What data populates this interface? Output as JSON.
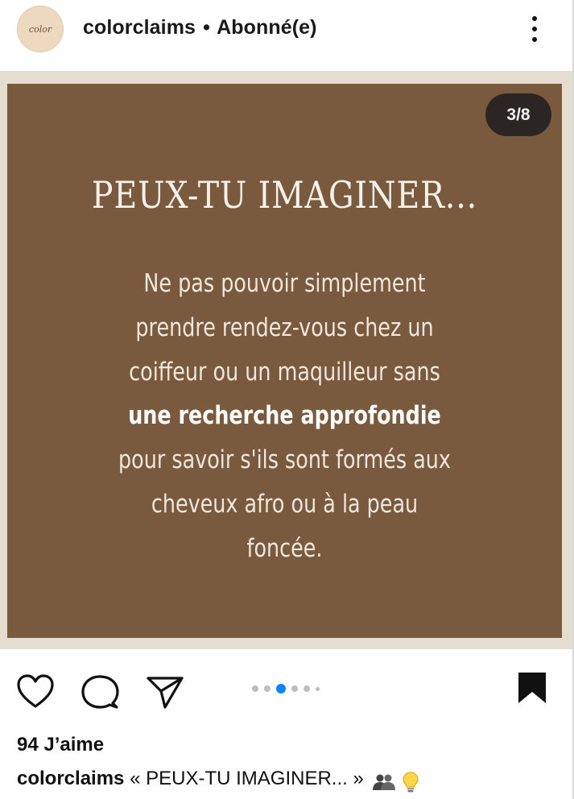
{
  "header": {
    "avatar_text": "color",
    "username": "colorclaims",
    "separator": "•",
    "follow_status": "Abonné(e)"
  },
  "post": {
    "counter": "3/8",
    "title": "PEUX-TU IMAGINER...",
    "body_lines": [
      "Ne pas pouvoir simplement",
      "prendre rendez-vous chez un",
      "coiffeur ou un maquilleur sans",
      "une recherche approfondie",
      "pour savoir s'ils sont formés aux",
      "cheveux afro ou à la peau",
      "foncée."
    ],
    "background_color": "#7a5a3f",
    "frame_color": "#e6ddd1"
  },
  "actions": {
    "icons": [
      "heart-icon",
      "comment-icon",
      "send-icon",
      "bookmark-icon"
    ],
    "carousel_active_index": 2,
    "accent_color": "#0a84ff"
  },
  "footer": {
    "likes": "94 J’aime",
    "caption_user": "colorclaims",
    "caption_text": "« PEUX-TU IMAGINER... »"
  }
}
